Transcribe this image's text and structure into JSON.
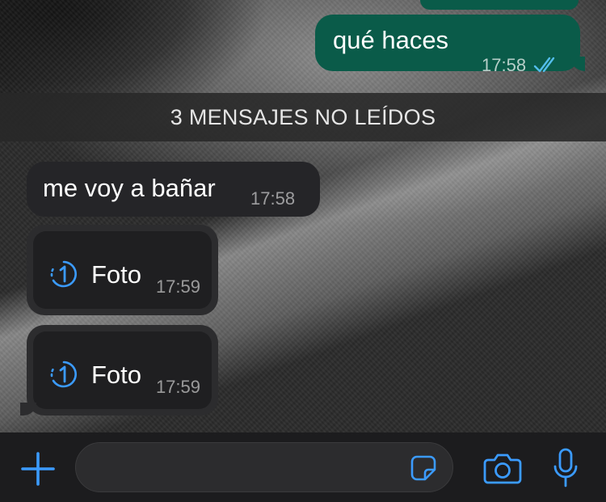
{
  "messages": {
    "outgoing": [
      {
        "text": "qué haces",
        "time": "17:58",
        "status": "read"
      }
    ],
    "unread_divider": "3 MENSAJES NO LEÍDOS",
    "incoming": [
      {
        "text": "me voy a bañar",
        "time": "17:58"
      },
      {
        "type": "view-once-photo",
        "label": "Foto",
        "time": "17:59"
      },
      {
        "type": "view-once-photo",
        "label": "Foto",
        "time": "17:59"
      }
    ]
  },
  "composer": {
    "input_value": "",
    "icons": [
      "plus-icon",
      "sticker-icon",
      "camera-icon",
      "microphone-icon"
    ]
  },
  "colors": {
    "accent": "#3b9bff",
    "outgoing_bubble": "#0a5b49",
    "incoming_bubble": "#252528",
    "read_ticks": "#53bdeb"
  }
}
